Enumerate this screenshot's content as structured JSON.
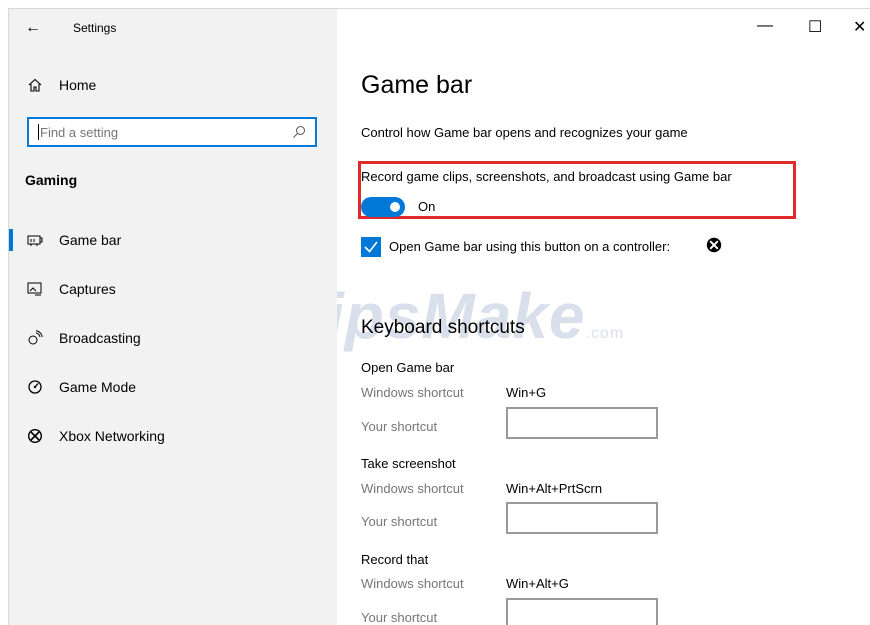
{
  "window": {
    "title": "Settings"
  },
  "sidebar": {
    "home_label": "Home",
    "search_placeholder": "Find a setting",
    "section_title": "Gaming",
    "items": [
      {
        "label": "Game bar",
        "icon": "game-bar-icon",
        "selected": true
      },
      {
        "label": "Captures",
        "icon": "captures-icon",
        "selected": false
      },
      {
        "label": "Broadcasting",
        "icon": "broadcasting-icon",
        "selected": false
      },
      {
        "label": "Game Mode",
        "icon": "game-mode-icon",
        "selected": false
      },
      {
        "label": "Xbox Networking",
        "icon": "xbox-icon",
        "selected": false
      }
    ]
  },
  "main": {
    "title": "Game bar",
    "description": "Control how Game bar opens and recognizes your game",
    "record_setting": {
      "label": "Record game clips, screenshots, and broadcast using Game bar",
      "state": "On",
      "on": true
    },
    "controller_setting": {
      "label": "Open Game bar using this button on a controller:",
      "checked": true
    },
    "shortcuts": {
      "title": "Keyboard shortcuts",
      "windows_label": "Windows shortcut",
      "your_label": "Your shortcut",
      "groups": [
        {
          "name": "Open Game bar",
          "windows": "Win+G",
          "yours": ""
        },
        {
          "name": "Take screenshot",
          "windows": "Win+Alt+PrtScrn",
          "yours": ""
        },
        {
          "name": "Record that",
          "windows": "Win+Alt+G",
          "yours": ""
        }
      ]
    }
  },
  "watermark": {
    "text": "TipsMake",
    "suffix": ".com"
  },
  "colors": {
    "accent": "#0078d7",
    "highlight": "#e0292b",
    "sidebar_bg": "#f2f2f2"
  }
}
